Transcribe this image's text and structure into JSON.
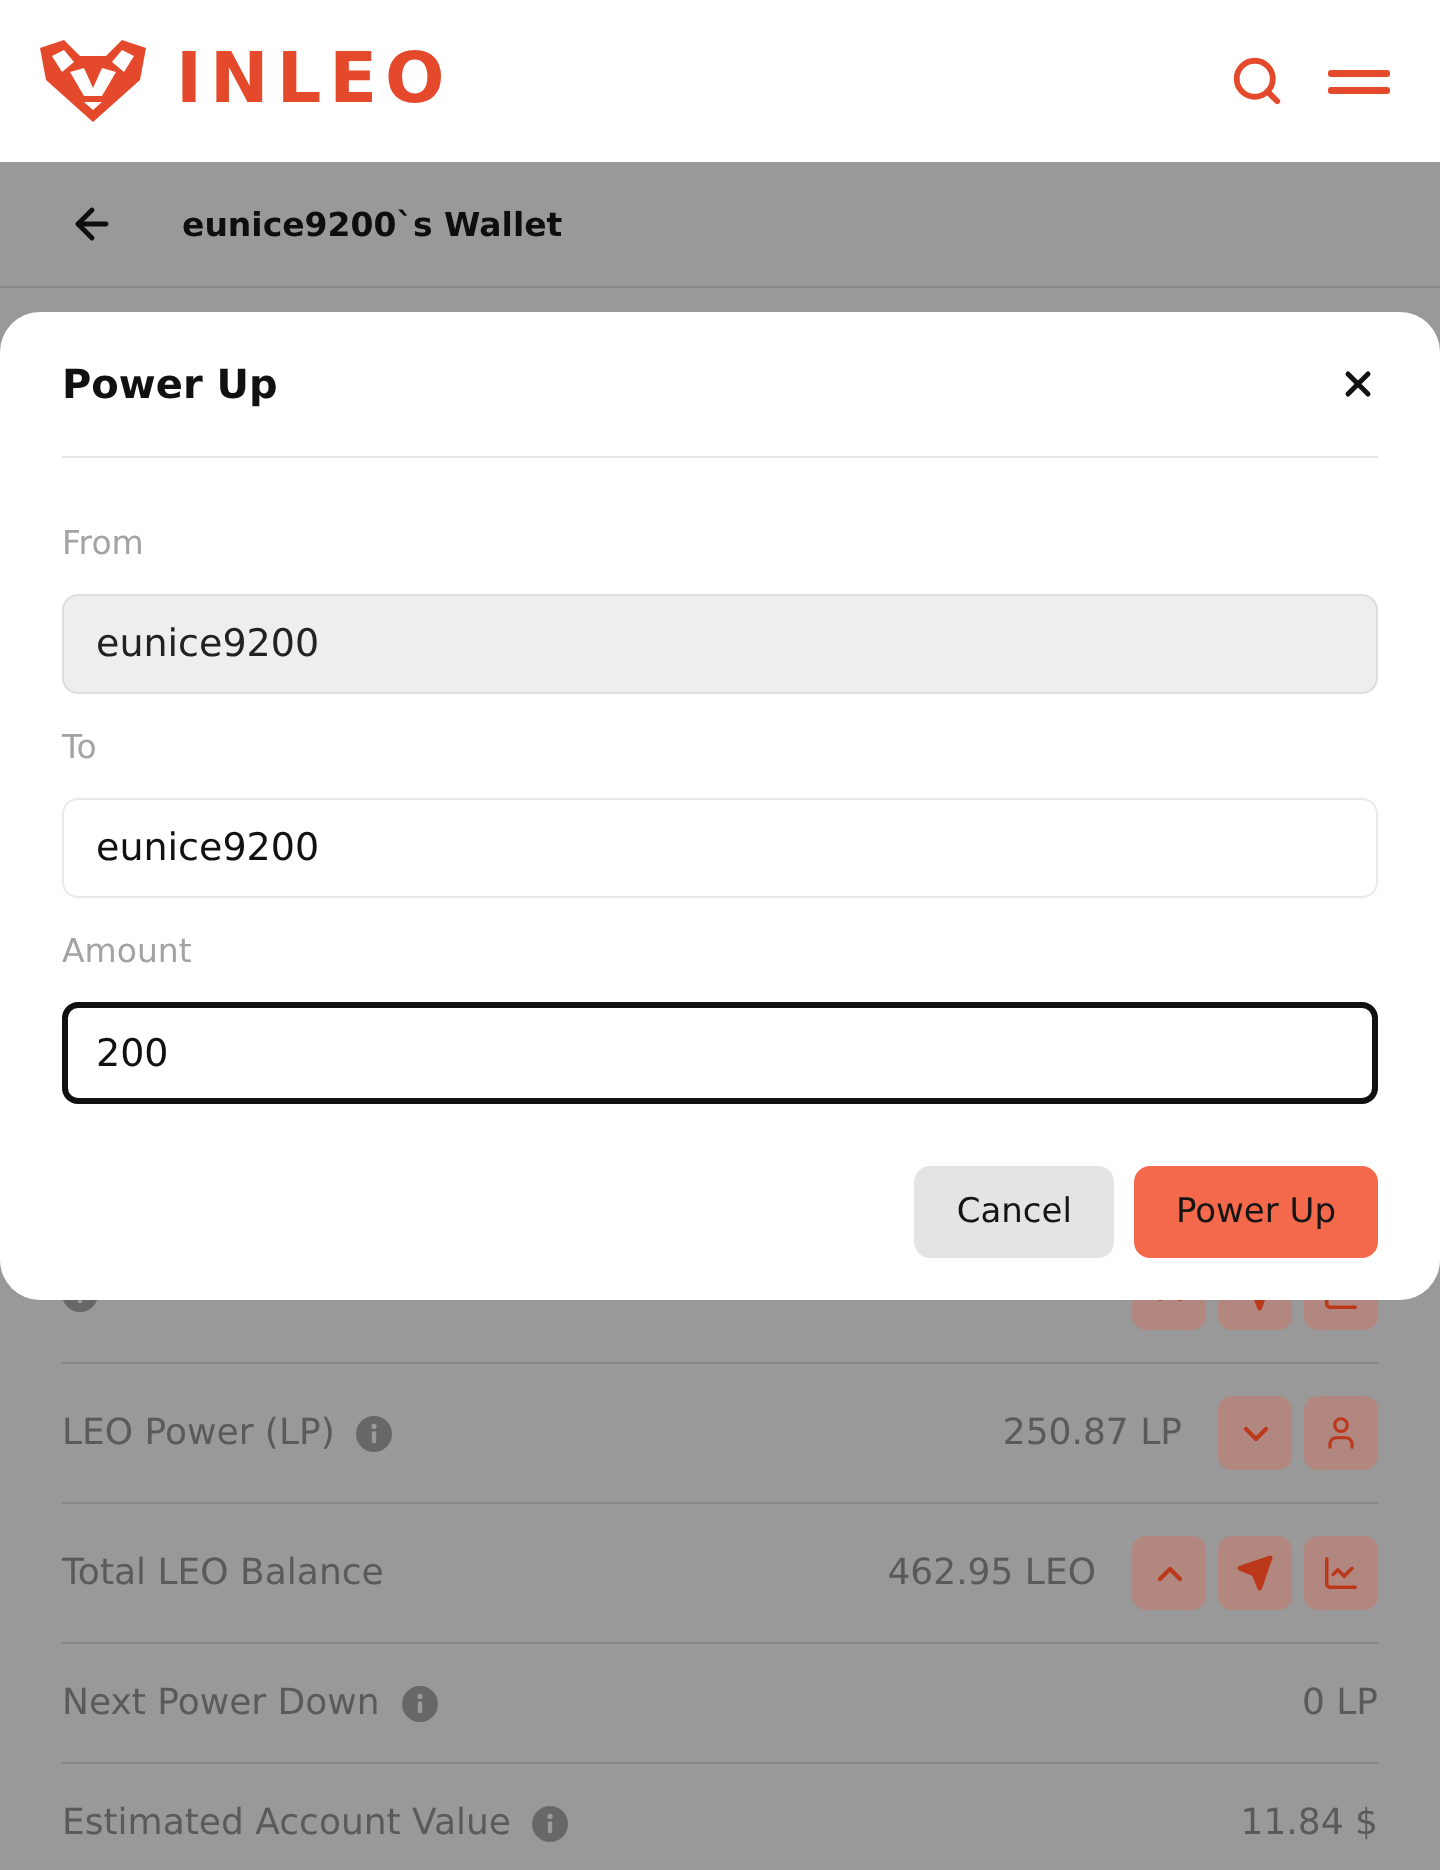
{
  "header": {
    "logo_text": "INLEO"
  },
  "page": {
    "title": "eunice9200`s Wallet"
  },
  "rows": [
    {
      "info": true,
      "buttons": [
        {
          "kind": "up"
        },
        {
          "kind": "send"
        },
        {
          "kind": "chart"
        }
      ]
    },
    {
      "label": "LEO Power (LP)",
      "info": true,
      "value": "250.87 LP",
      "buttons": [
        {
          "kind": "down"
        },
        {
          "kind": "user"
        }
      ]
    },
    {
      "label": "Total LEO Balance",
      "info": false,
      "value": "462.95 LEO",
      "buttons": [
        {
          "kind": "up"
        },
        {
          "kind": "send"
        },
        {
          "kind": "chart"
        }
      ]
    },
    {
      "label": "Next Power Down",
      "info": true,
      "value": "0 LP",
      "buttons": []
    },
    {
      "label": "Estimated Account Value",
      "info": true,
      "value": "11.84 $",
      "buttons": []
    }
  ],
  "modal": {
    "title": "Power Up",
    "fields": [
      {
        "label": "From",
        "value": "eunice9200",
        "disabled": true,
        "focused": false
      },
      {
        "label": "To",
        "value": "eunice9200",
        "disabled": false,
        "focused": false
      },
      {
        "label": "Amount",
        "value": "200",
        "disabled": false,
        "focused": true
      }
    ],
    "buttons": [
      {
        "label": "Cancel",
        "kind": "secondary"
      },
      {
        "label": "Power Up",
        "kind": "primary"
      }
    ]
  }
}
